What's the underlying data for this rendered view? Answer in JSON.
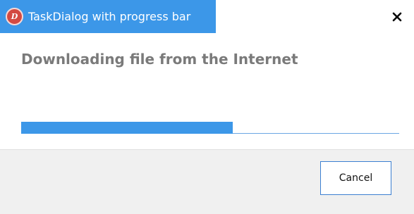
{
  "window": {
    "title": "TaskDialog with progress bar",
    "app_icon": "app-logo-icon",
    "close_icon": "close-icon"
  },
  "main": {
    "heading": "Downloading file from the Internet",
    "progress": 0.56
  },
  "footer": {
    "cancel_label": "Cancel"
  },
  "colors": {
    "accent": "#3c97e8",
    "heading_text": "#7a7a7a",
    "footer_bg": "#f0f0f0"
  }
}
